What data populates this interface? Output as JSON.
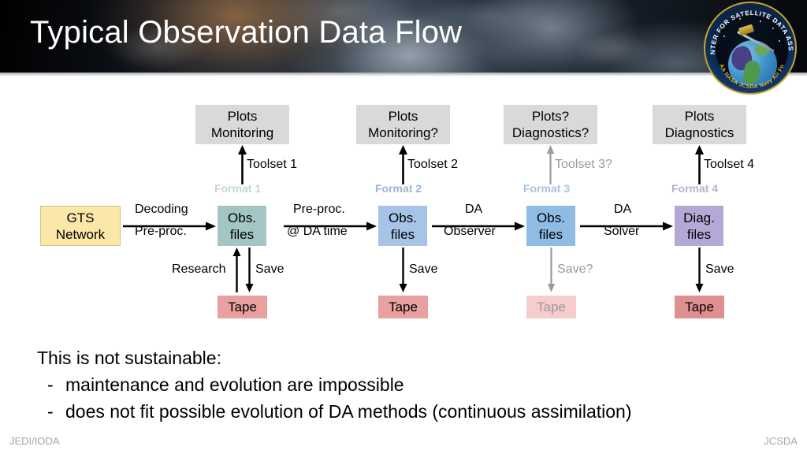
{
  "header": {
    "title": "Typical Observation Data Flow",
    "logo": {
      "name": "jcsda-logo",
      "arc_text": "JOINT CENTER FOR SATELLITE DATA ASSIMILATION",
      "agency_text": "NOAA   NASA   JCSDA   Navy   Air Force"
    }
  },
  "diagram": {
    "gts": {
      "line1": "GTS",
      "line2": "Network"
    },
    "columns": [
      {
        "plots": {
          "line1": "Plots",
          "line2": "Monitoring"
        },
        "toolset": "Toolset 1",
        "format": "Format 1",
        "format_color": "#c3d6cd",
        "node": {
          "line1": "Obs.",
          "line2": "files"
        },
        "node_color": "#a3c5c4",
        "transition_top": "Decoding",
        "transition_bottom": "Pre-proc.",
        "down_label": "Save",
        "up_label": "Research",
        "tape": "Tape",
        "tape_color": "#e8a0a0",
        "faded": false
      },
      {
        "plots": {
          "line1": "Plots",
          "line2": "Monitoring?"
        },
        "toolset": "Toolset 2",
        "format": "Format 2",
        "format_color": "#9fb6d4",
        "node": {
          "line1": "Obs.",
          "line2": "files"
        },
        "node_color": "#a8c3e8",
        "transition_top": "Pre-proc.",
        "transition_bottom": "@ DA time",
        "down_label": "Save",
        "up_label": "",
        "tape": "Tape",
        "tape_color": "#e8a0a0",
        "faded": false
      },
      {
        "plots": {
          "line1": "Plots?",
          "line2": "Diagnostics?"
        },
        "toolset": "Toolset 3?",
        "format": "Format 3",
        "format_color": "#a9c4de",
        "node": {
          "line1": "Obs.",
          "line2": "files"
        },
        "node_color": "#8fbce4",
        "transition_top": "DA",
        "transition_bottom": "Observer",
        "down_label": "Save?",
        "up_label": "",
        "tape": "Tape",
        "tape_color": "#f5cdcd",
        "faded": true
      },
      {
        "plots": {
          "line1": "Plots",
          "line2": "Diagnostics"
        },
        "toolset": "Toolset 4",
        "format": "Format 4",
        "format_color": "#b6b3d6",
        "node": {
          "line1": "Diag.",
          "line2": "files"
        },
        "node_color": "#b4a8d6",
        "transition_top": "DA",
        "transition_bottom": "Solver",
        "down_label": "Save",
        "up_label": "",
        "tape": "Tape",
        "tape_color": "#e08f90",
        "faded": false
      }
    ]
  },
  "conclusion": {
    "heading": "This is not sustainable:",
    "bullet_marker": "-",
    "bullets": [
      "maintenance and evolution are impossible",
      "does not fit possible evolution of DA methods (continuous assimilation)"
    ]
  },
  "footer": {
    "left": "JEDI/IODA",
    "right": "JCSDA"
  }
}
